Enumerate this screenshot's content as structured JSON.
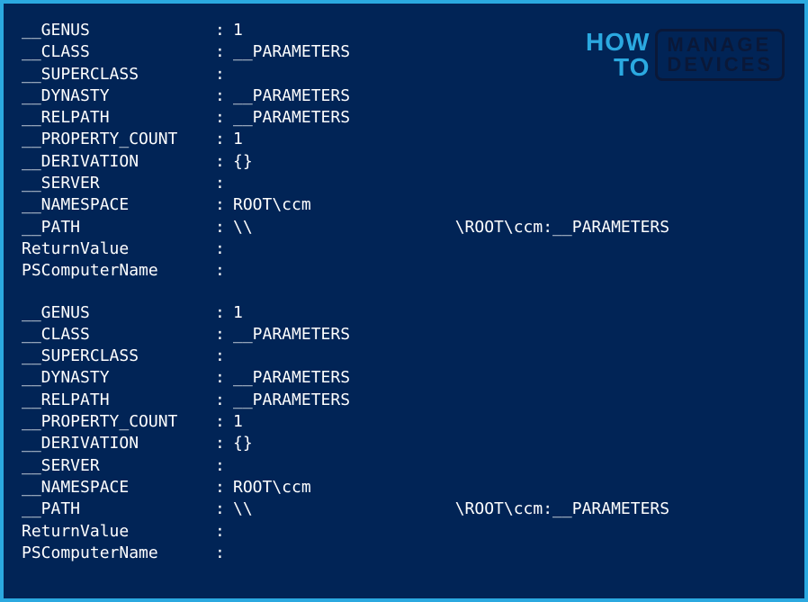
{
  "watermark": {
    "how": "HOW",
    "to": "TO",
    "manage": "MANAGE",
    "devices": "DEVICES"
  },
  "blocks": [
    {
      "genus_label": "__GENUS",
      "genus_value": "1",
      "class_label": "__CLASS",
      "class_value": "__PARAMETERS",
      "superclass_label": "__SUPERCLASS",
      "superclass_value": "",
      "dynasty_label": "__DYNASTY",
      "dynasty_value": "__PARAMETERS",
      "relpath_label": "__RELPATH",
      "relpath_value": "__PARAMETERS",
      "property_count_label": "__PROPERTY_COUNT",
      "property_count_value": "1",
      "derivation_label": "__DERIVATION",
      "derivation_value": "{}",
      "server_label": "__SERVER",
      "server_value": "",
      "namespace_label": "__NAMESPACE",
      "namespace_value": "ROOT\\ccm",
      "path_label": "__PATH",
      "path_prefix": "\\\\",
      "path_suffix": "\\ROOT\\ccm:__PARAMETERS",
      "returnvalue_label": "ReturnValue",
      "returnvalue_value": "",
      "pscomputername_label": "PSComputerName",
      "pscomputername_value": ""
    },
    {
      "genus_label": "__GENUS",
      "genus_value": "1",
      "class_label": "__CLASS",
      "class_value": "__PARAMETERS",
      "superclass_label": "__SUPERCLASS",
      "superclass_value": "",
      "dynasty_label": "__DYNASTY",
      "dynasty_value": "__PARAMETERS",
      "relpath_label": "__RELPATH",
      "relpath_value": "__PARAMETERS",
      "property_count_label": "__PROPERTY_COUNT",
      "property_count_value": "1",
      "derivation_label": "__DERIVATION",
      "derivation_value": "{}",
      "server_label": "__SERVER",
      "server_value": "",
      "namespace_label": "__NAMESPACE",
      "namespace_value": "ROOT\\ccm",
      "path_label": "__PATH",
      "path_prefix": "\\\\",
      "path_suffix": "\\ROOT\\ccm:__PARAMETERS",
      "returnvalue_label": "ReturnValue",
      "returnvalue_value": "",
      "pscomputername_label": "PSComputerName",
      "pscomputername_value": ""
    }
  ],
  "separator": ":"
}
